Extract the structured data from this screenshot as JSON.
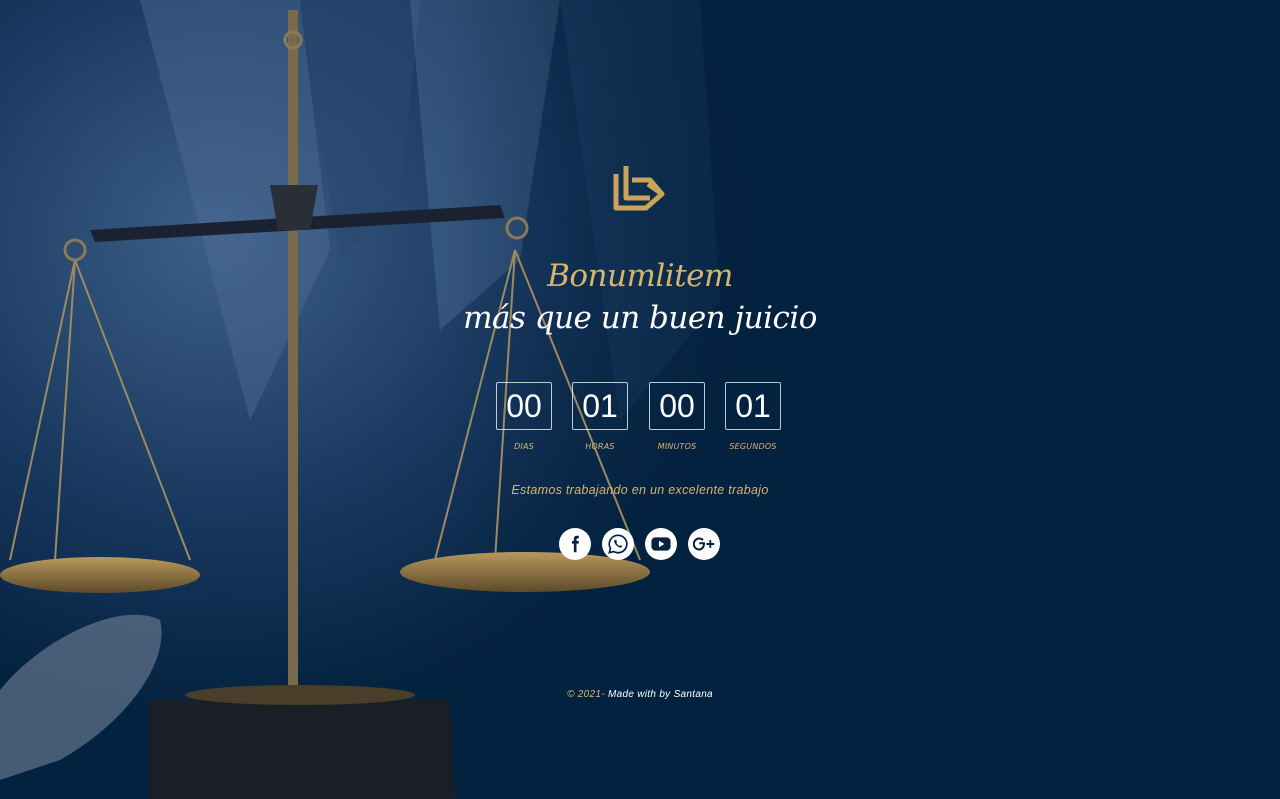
{
  "brand": {
    "name": "Bonumlitem",
    "tagline": "más que un buen juicio",
    "logo_icon": "bonumlitem-logo-icon",
    "accent_color": "#d7b56d",
    "background_color": "#03223f"
  },
  "countdown": [
    {
      "value": "00",
      "label": "DIAS"
    },
    {
      "value": "01",
      "label": "HORAS"
    },
    {
      "value": "00",
      "label": "MINUTOS"
    },
    {
      "value": "01",
      "label": "SEGUNDOS"
    }
  ],
  "message": "Estamos trabajando en un excelente trabajo",
  "social": [
    {
      "icon": "facebook-icon"
    },
    {
      "icon": "whatsapp-icon"
    },
    {
      "icon": "youtube-icon"
    },
    {
      "icon": "google-plus-icon"
    }
  ],
  "footer": {
    "year": "© 2021-",
    "text": " Made with by Santana"
  }
}
